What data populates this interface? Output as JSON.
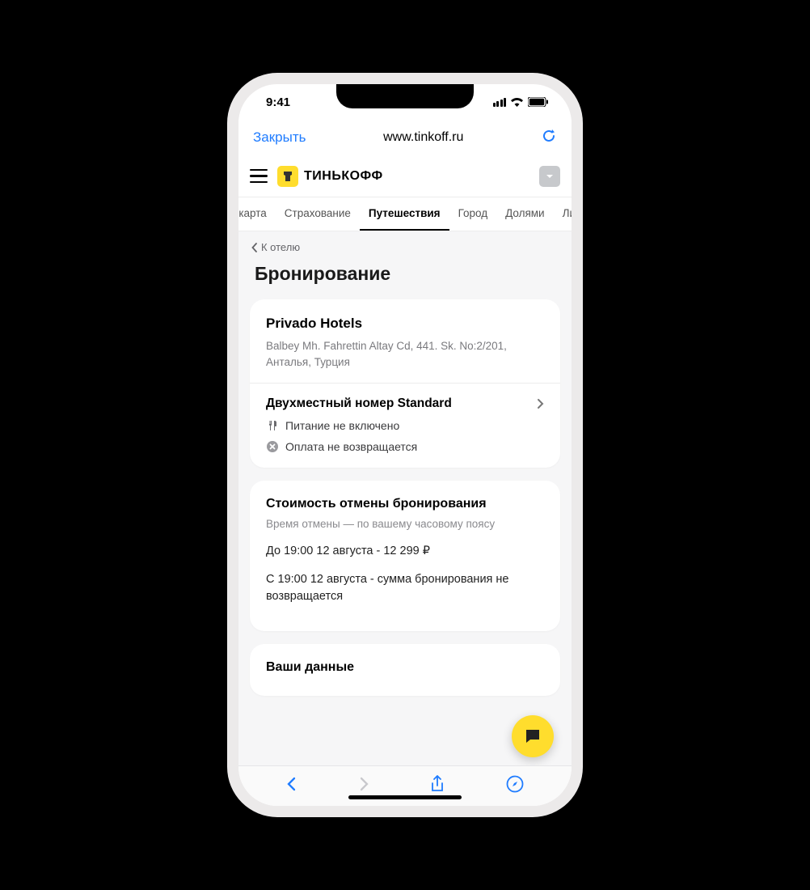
{
  "status": {
    "time": "9:41"
  },
  "browser": {
    "close_label": "Закрыть",
    "url": "www.tinkoff.ru"
  },
  "header": {
    "brand": "ТИНЬКОФФ"
  },
  "tabs": {
    "items": [
      {
        "label": "им-карта"
      },
      {
        "label": "Страхование"
      },
      {
        "label": "Путешествия",
        "active": true
      },
      {
        "label": "Город"
      },
      {
        "label": "Долями"
      },
      {
        "label": "Лични"
      }
    ]
  },
  "back": {
    "label": "К отелю"
  },
  "page": {
    "title": "Бронирование"
  },
  "hotel": {
    "name": "Privado Hotels",
    "address": "Balbey Mh. Fahrettin Altay Cd, 441. Sk. No:2/201, Анталья, Турция",
    "room": "Двухместный номер Standard",
    "meal": "Питание не включено",
    "refund": "Оплата не возвращается"
  },
  "cancel": {
    "title": "Стоимость отмены бронирования",
    "subtitle": "Время отмены — по вашему часовому поясу",
    "line1": "До 19:00 12 августа - 12 299 ₽",
    "line2": "С 19:00 12 августа - сумма бронирования не возвращается"
  },
  "user_data": {
    "title": "Ваши данные"
  }
}
